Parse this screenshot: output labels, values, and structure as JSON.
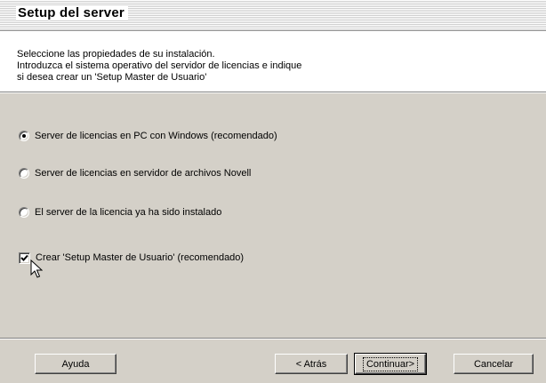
{
  "header": {
    "title": "Setup del server"
  },
  "description": {
    "lines": [
      "Seleccione las propiedades de su instalación.",
      "Introduzca el sistema operativo del servidor de licencias e indique",
      "si desea crear un 'Setup Master de Usuario'"
    ]
  },
  "options": [
    {
      "label": "Server de licencias en PC con Windows (recomendado)",
      "selected": true
    },
    {
      "label": "Server de licencias en servidor de archivos Novell",
      "selected": false
    },
    {
      "label": "El server de la licencia ya  ha sido instalado",
      "selected": false
    }
  ],
  "checkbox": {
    "label": "Crear 'Setup Master de Usuario' (recomendado)",
    "checked": true
  },
  "buttons": {
    "help": "Ayuda",
    "back": "< Atrás",
    "continue": "Continuar>",
    "cancel": "Cancelar"
  }
}
